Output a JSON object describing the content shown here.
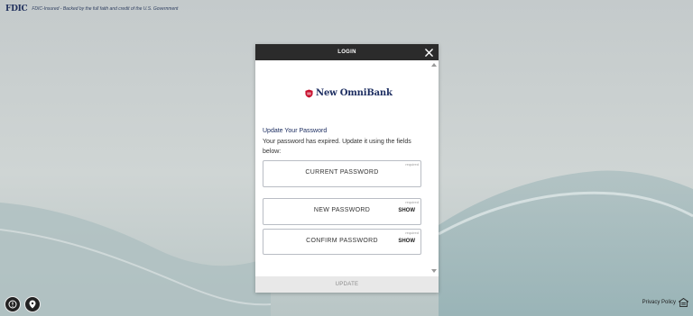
{
  "banner": {
    "fdic_logo": "FDIC",
    "fdic_text": "FDIC-Insured - Backed by the full faith and credit of the U.S. Government"
  },
  "modal": {
    "title": "LOGIN",
    "brand_name": "New OmniBank",
    "section_title": "Update Your Password",
    "section_desc": "Your password has expired. Update it using the fields below:",
    "fields": [
      {
        "label": "CURRENT PASSWORD",
        "required": "required",
        "show": ""
      },
      {
        "label": "NEW PASSWORD",
        "required": "required",
        "show": "SHOW"
      },
      {
        "label": "CONFIRM PASSWORD",
        "required": "required",
        "show": "SHOW"
      }
    ],
    "update_label": "UPDATE"
  },
  "footer": {
    "privacy_policy": "Privacy Policy",
    "icons": [
      "info-icon",
      "location-pin-icon",
      "home-lender-icon"
    ]
  },
  "colors": {
    "header_bg": "#2b2b2b",
    "brand_navy": "#1d2e61",
    "brand_red": "#c8102e",
    "update_bar_bg": "#e8e8e8"
  }
}
